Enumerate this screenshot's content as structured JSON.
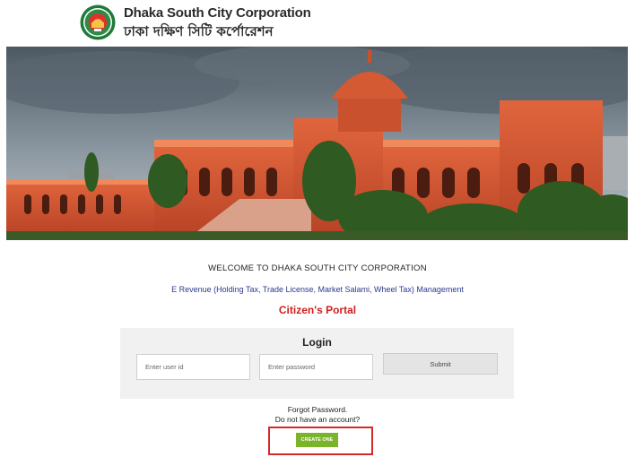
{
  "header": {
    "brand_en": "Dhaka South City Corporation",
    "brand_bn": "ঢাকা দক্ষিণ সিটি কর্পোরেশন"
  },
  "banner": {
    "image": "ahsan-manzil-building-photo"
  },
  "welcome": {
    "title": "WELCOME TO DHAKA SOUTH CITY CORPORATION",
    "subtitle": "E Revenue (Holding Tax, Trade License, Market Salami, Wheel Tax) Management",
    "portal": "Citizen's Portal"
  },
  "login": {
    "title": "Login",
    "user_placeholder": "Enter user id",
    "password_placeholder": "Enter password",
    "submit_label": "Submit"
  },
  "links": {
    "forgot": "Forgot Password.",
    "no_account": "Do not have an account?",
    "create_label": "CREATE ONE"
  },
  "colors": {
    "portal_red": "#d11f1f",
    "link_blue": "#2a3a8f",
    "create_green": "#7bb32a",
    "highlight_red": "#d42a2a"
  }
}
